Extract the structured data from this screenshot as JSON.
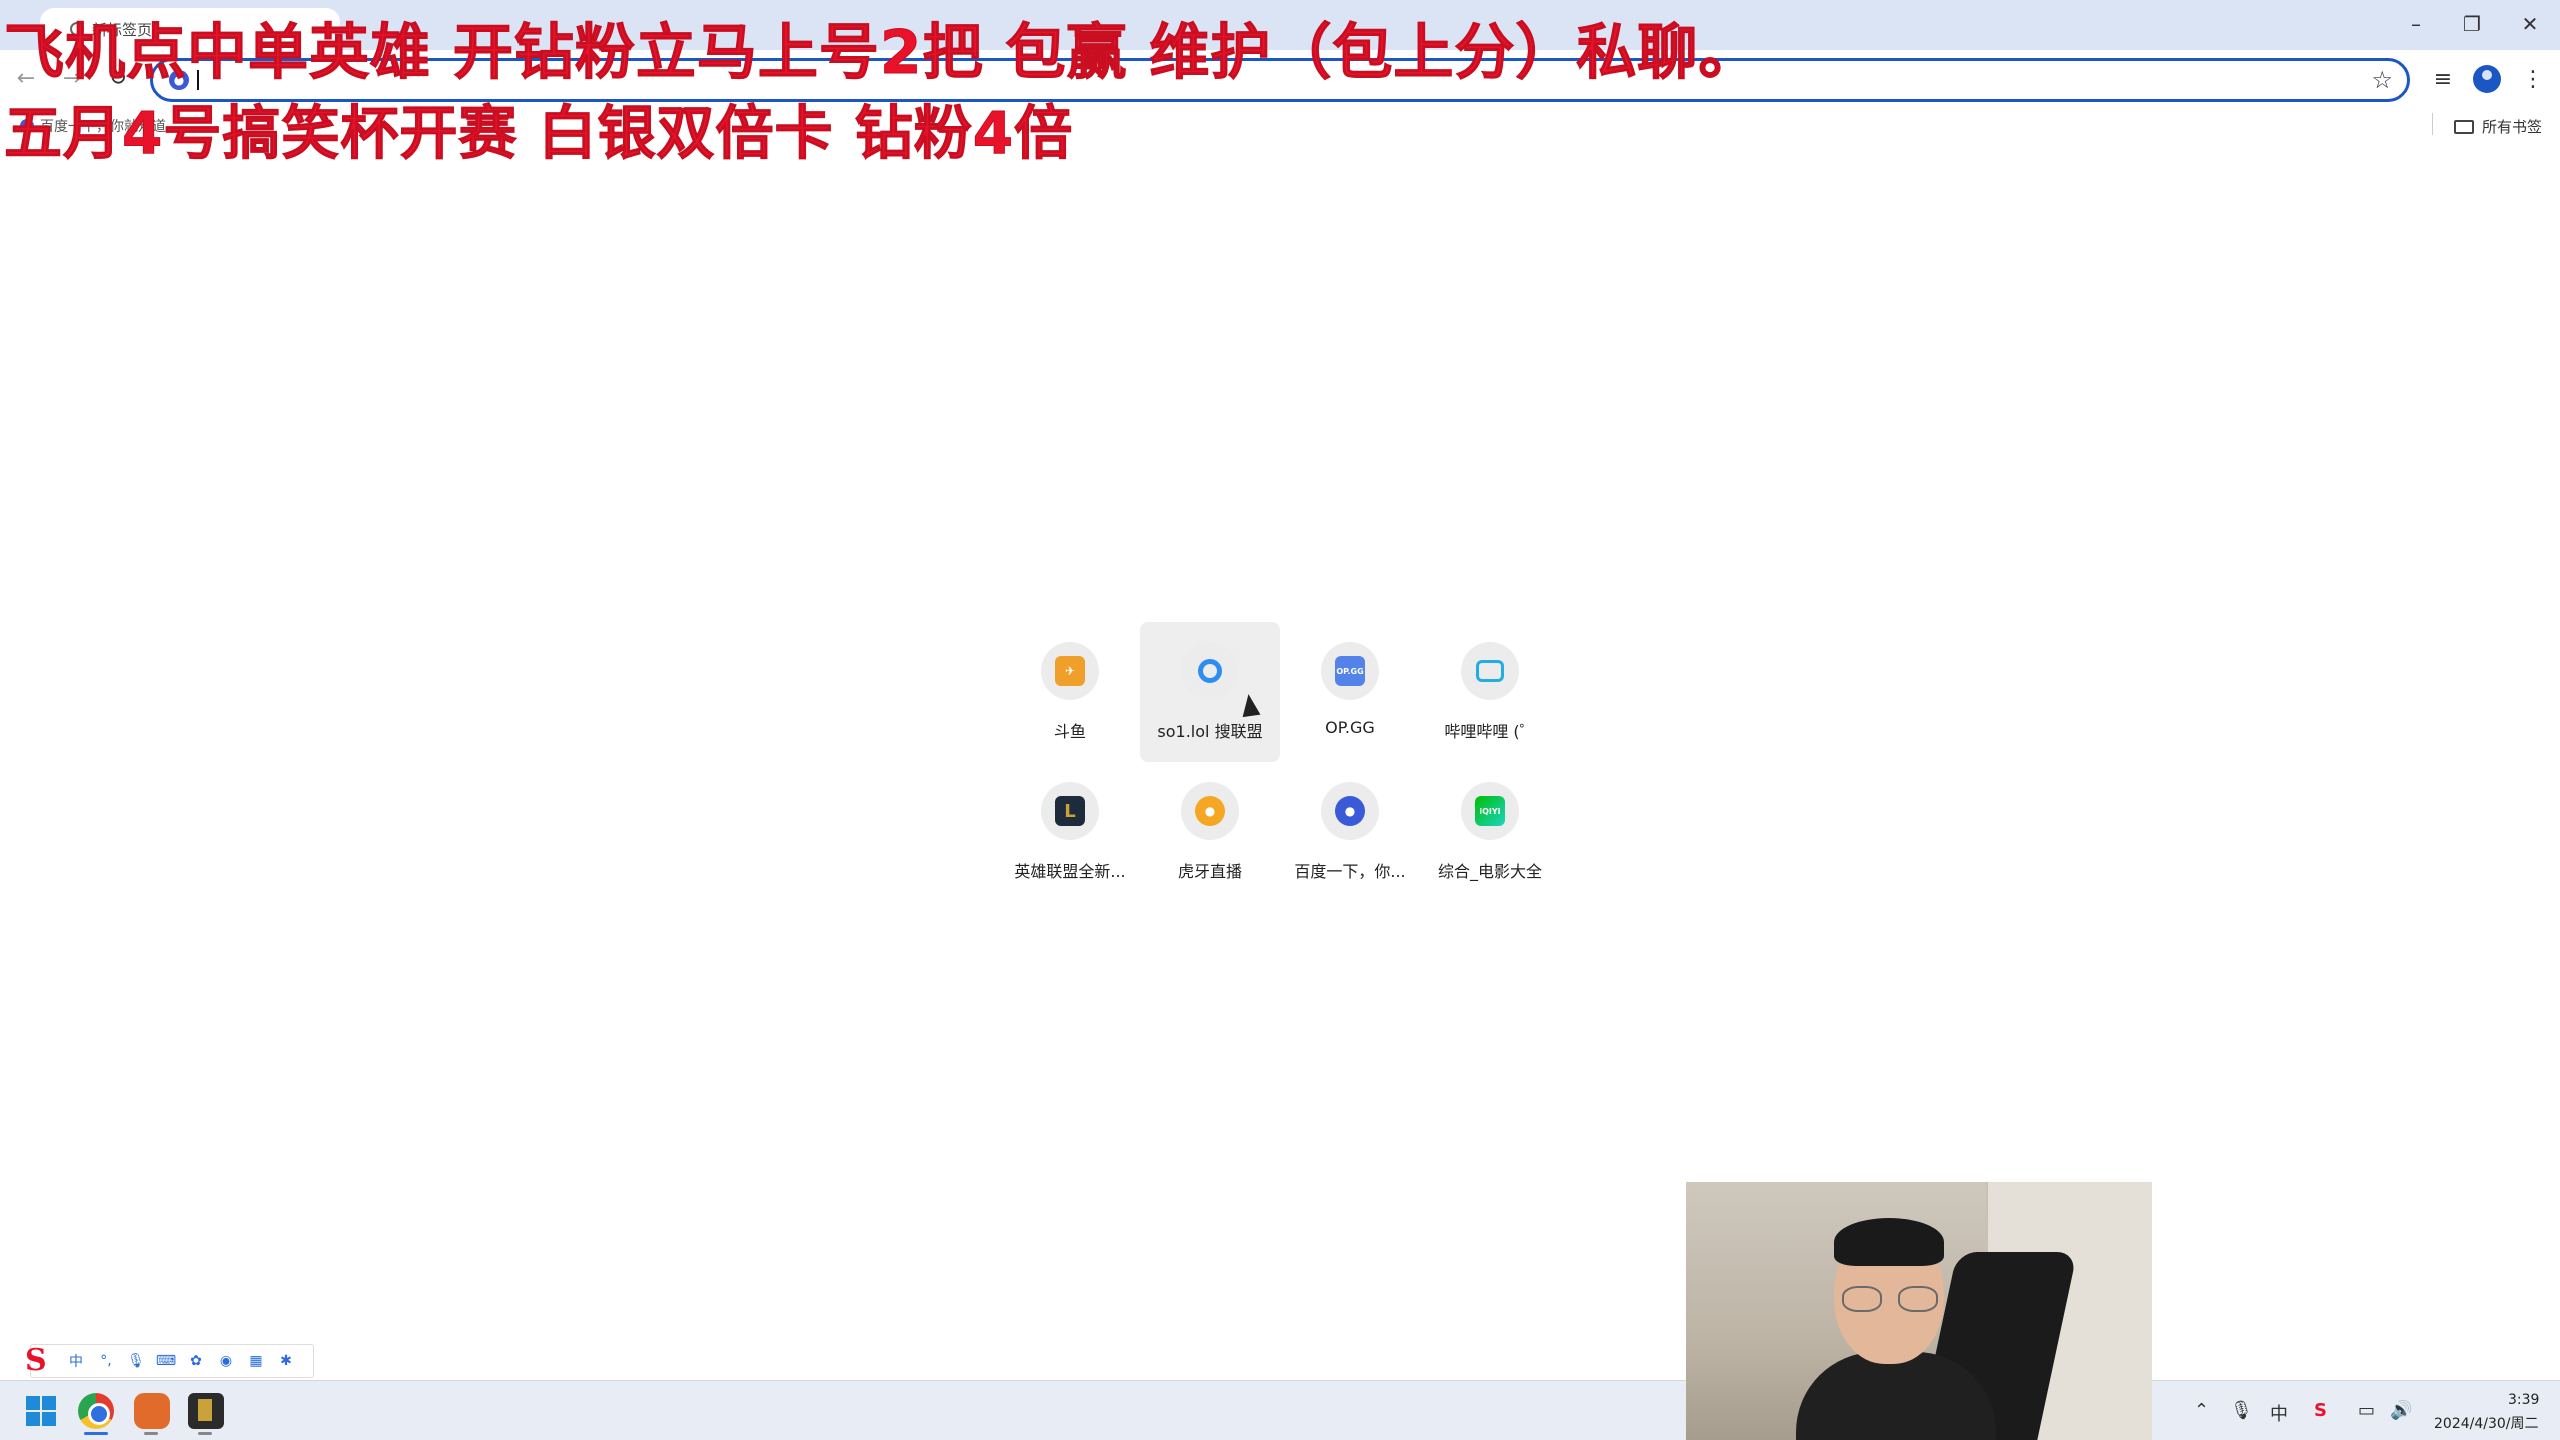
{
  "browser": {
    "tab_title": "新标签页",
    "bookmarks": [
      "百度一下，你就知道"
    ],
    "all_bookmarks_label": "所有书签"
  },
  "overlay": {
    "line1": "飞机点中单英雄   开钻粉立马上号2把 包赢  维护（包上分）私聊。",
    "line2": "五月4号搞笑杯开赛  白银双倍卡  钻粉4倍"
  },
  "shortcuts": [
    {
      "label": "斗鱼",
      "icon": "douyu-icon",
      "color": "#f0a02a"
    },
    {
      "label": "so1.lol 搜联盟",
      "icon": "so1lol-icon",
      "color": "#2e8ef0"
    },
    {
      "label": "OP.GG",
      "icon": "opgg-icon",
      "color": "#5383e8",
      "glyph": "OP.GG"
    },
    {
      "label": "哔哩哔哩 (゜",
      "icon": "bilibili-icon",
      "color": "#23ade5"
    },
    {
      "label": "英雄联盟全新...",
      "icon": "lol-icon",
      "color": "#1d2b3a"
    },
    {
      "label": "虎牙直播",
      "icon": "huya-icon",
      "color": "#f5a623"
    },
    {
      "label": "百度一下，你...",
      "icon": "baidu-icon",
      "color": "#3a5ad8"
    },
    {
      "label": "综合_电影大全",
      "icon": "iqiyi-icon",
      "color": "#00be06",
      "glyph": "iQIYI"
    }
  ],
  "ime": {
    "logo": "S",
    "mode": "中"
  },
  "taskbar": {
    "time": "3:39",
    "date": "2024/4/30/周二"
  }
}
